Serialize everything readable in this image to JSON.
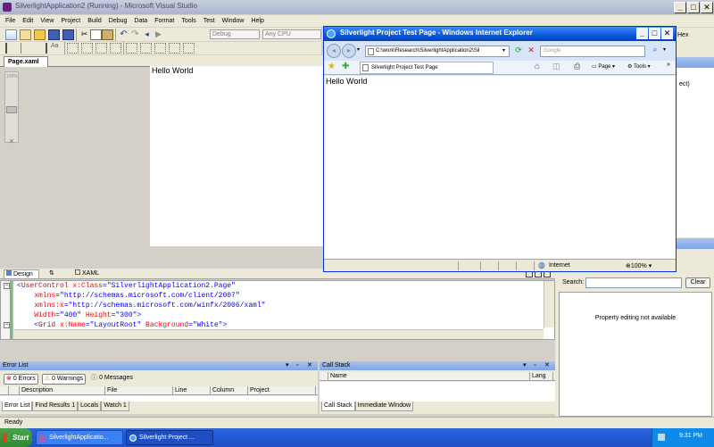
{
  "vs": {
    "title": "SilverlightApplication2 (Running) - Microsoft Visual Studio",
    "menu": [
      "File",
      "Edit",
      "View",
      "Project",
      "Build",
      "Debug",
      "Data",
      "Format",
      "Tools",
      "Test",
      "Window",
      "Help"
    ],
    "solution_config": "Debug",
    "platform": "Any CPU",
    "doc_tab": "Page.xaml",
    "hex_label": "Hex",
    "designer_text": "Hello World",
    "view_tabs": {
      "design": "Design",
      "swap": "⇅",
      "xaml": "XAML"
    },
    "code_lines": [
      {
        "parts": [
          {
            "t": "<",
            "c": "bl"
          },
          {
            "t": "UserControl",
            "c": "kw"
          },
          {
            "t": " x:Class",
            "c": "at"
          },
          {
            "t": "=\"SilverlightApplication2.Page\"",
            "c": "bl"
          }
        ]
      },
      {
        "parts": [
          {
            "t": "    xmlns",
            "c": "at"
          },
          {
            "t": "=\"http://schemas.microsoft.com/client/2007\"",
            "c": "bl"
          }
        ]
      },
      {
        "parts": [
          {
            "t": "    xmlns:x",
            "c": "at"
          },
          {
            "t": "=\"http://schemas.microsoft.com/winfx/2006/xaml\"",
            "c": "bl"
          }
        ]
      },
      {
        "parts": [
          {
            "t": "    Width",
            "c": "at"
          },
          {
            "t": "=\"400\"",
            "c": "bl"
          },
          {
            "t": " Height",
            "c": "at"
          },
          {
            "t": "=\"300\"",
            "c": "bl"
          },
          {
            "t": ">",
            "c": "bl"
          }
        ]
      },
      {
        "parts": [
          {
            "t": "    <",
            "c": "bl"
          },
          {
            "t": "Grid",
            "c": "kw"
          },
          {
            "t": " x:Name",
            "c": "at"
          },
          {
            "t": "=\"LayoutRoot\"",
            "c": "bl"
          },
          {
            "t": " Background",
            "c": "at"
          },
          {
            "t": "=\"White\"",
            "c": "bl"
          },
          {
            "t": ">",
            "c": "bl"
          }
        ]
      },
      {
        "parts": [
          {
            "t": "        <",
            "c": "bl"
          },
          {
            "t": "TextBlock",
            "c": "kw"
          },
          {
            "t": ">Hello World</",
            "c": "bl"
          },
          {
            "t": "TextBlock",
            "c": "kw"
          },
          {
            "t": ">",
            "c": "bl"
          }
        ]
      }
    ],
    "zoom_ruler": "100%",
    "right_partial": "ect)",
    "search_label": "Search:",
    "clear_button": "Clear",
    "property_message": "Property editing not available",
    "status": "Ready"
  },
  "error_list": {
    "title": "Error List",
    "errors": "0 Errors",
    "warnings": "0 Warnings",
    "messages": "0 Messages",
    "columns": [
      "",
      "Description",
      "File",
      "Line",
      "Column",
      "Project"
    ]
  },
  "bottom_tabs": [
    "Error List",
    "Find Results 1",
    "Locals",
    "Watch 1"
  ],
  "call_stack": {
    "title": "Call Stack",
    "columns": [
      "Name",
      "Lang"
    ],
    "tabs": [
      "Call Stack",
      "Immediate Window"
    ]
  },
  "ie": {
    "title": "Silverlight Project Test Page - Windows Internet Explorer",
    "address": "C:\\work\\Research\\SilverlightApplication2\\Sil",
    "search_placeholder": "Google",
    "tab_title": "Silverlight Project Test Page",
    "page_label": "Page",
    "tools_label": "Tools",
    "content": "Hello World",
    "zone": "Internet",
    "zoom": "100%"
  },
  "taskbar": {
    "start": "Start",
    "items": [
      "SilverlightApplicatio...",
      "Silverlight Project ..."
    ],
    "clock": "9:31 PM"
  },
  "colors": {
    "vs_title": "#0a246a",
    "xp_blue": "#245edb",
    "ie_chrome": "#d8e4f8"
  }
}
